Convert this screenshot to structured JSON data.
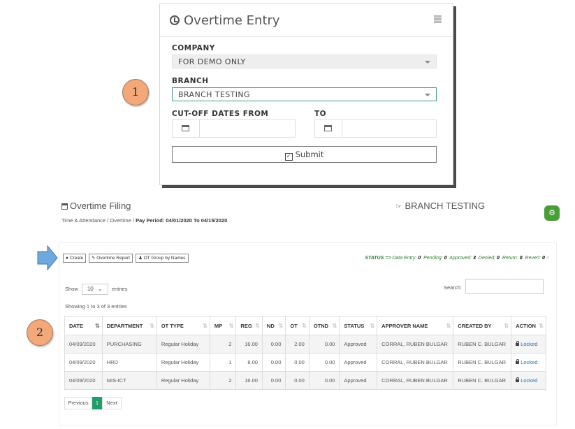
{
  "entry_form": {
    "title": "Overtime Entry",
    "company_label": "COMPANY",
    "company_value": "FOR DEMO ONLY",
    "branch_label": "BRANCH",
    "branch_value": "BRANCH TESTING",
    "cutoff_from_label": "CUT-OFF DATES FROM",
    "to_label": "TO",
    "submit_label": "Submit"
  },
  "callouts": {
    "one": "1",
    "two": "2"
  },
  "page_header": {
    "title": "Overtime Filing",
    "branch": "BRANCH TESTING",
    "crumb_1": "Time & Attendance",
    "crumb_sep": "/",
    "crumb_2": "Overtime",
    "pay_period": "Pay Period: 04/01/2020 To 04/15/2020"
  },
  "toolbar": {
    "create": "Create",
    "report": "Overtime Report",
    "group": "OT Group by Names"
  },
  "status_bar": {
    "label": "STATUS =>",
    "data_entry_label": "Data Entry:",
    "data_entry": "0",
    "pending_label": "Pending:",
    "pending": "0",
    "approved_label": "Approved:",
    "approved": "3",
    "denied_label": "Denied:",
    "denied": "0",
    "return_label": "Return:",
    "return": "0",
    "revert_label": "Revert:",
    "revert": "0"
  },
  "table_controls": {
    "show_label": "Show",
    "page_size": "10",
    "entries_label": "entries",
    "search_label": "Search:",
    "info": "Showing 1 to 3 of 3 entries"
  },
  "table": {
    "columns": [
      "DATE",
      "DEPARTMENT",
      "OT TYPE",
      "MP",
      "REG",
      "ND",
      "OT",
      "OTND",
      "STATUS",
      "APPROVER NAME",
      "CREATED BY",
      "ACTION"
    ],
    "rows": [
      [
        "04/09/2020",
        "PURCHASING",
        "Regular Holiday",
        "2",
        "16.00",
        "0.00",
        "2.00",
        "0.00",
        "Approved",
        "CORRAL, RUBEN BULGAR",
        "RUBEN C. BULGAR",
        "Locked"
      ],
      [
        "04/09/2020",
        "HRD",
        "Regular Holiday",
        "1",
        "8.00",
        "0.00",
        "0.00",
        "0.00",
        "Approved",
        "CORRAL, RUBEN BULGAR",
        "RUBEN C. BULGAR",
        "Locked"
      ],
      [
        "04/09/2020",
        "MIS-ICT",
        "Regular Holiday",
        "2",
        "16.00",
        "0.00",
        "0.00",
        "0.00",
        "Approved",
        "CORRAL, RUBEN BULGAR",
        "RUBEN C. BULGAR",
        "Locked"
      ]
    ]
  },
  "pagination": {
    "previous": "Previous",
    "current": "1",
    "next": "Next"
  },
  "colors": {
    "accent": "#1f9e6a",
    "status_green": "#2e7d2e",
    "callout": "#f2a878",
    "arrow": "#6fa8dc"
  }
}
